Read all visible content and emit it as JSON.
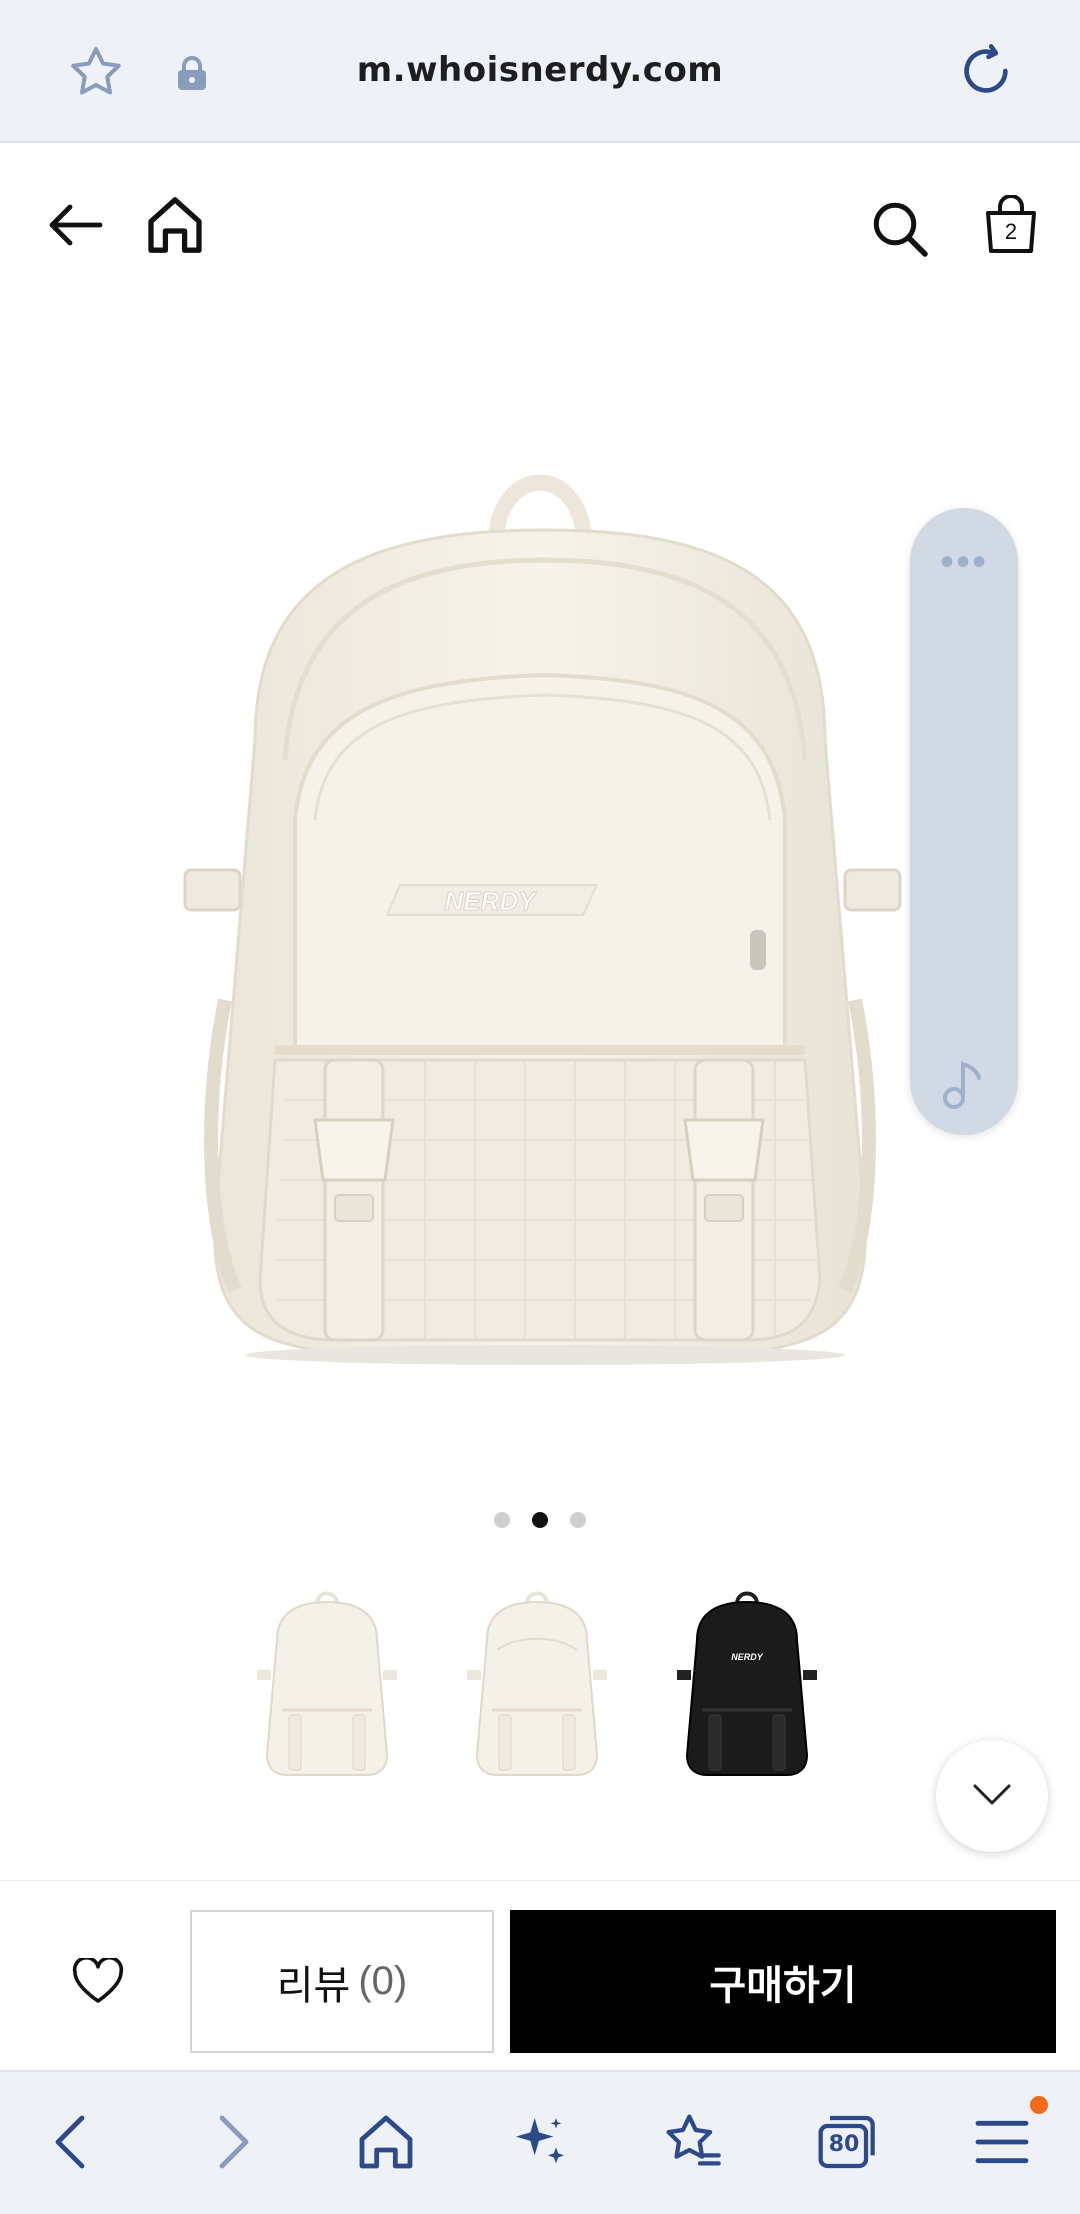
{
  "browser": {
    "url": "m.whoisnerdy.com",
    "tab_count": "80"
  },
  "header": {
    "cart_count": "2"
  },
  "product": {
    "logo_text": "NERDY",
    "thumb_logo_text": "NERDY",
    "image_index": 2,
    "image_total": 3
  },
  "actions": {
    "review_label": "리뷰",
    "review_count": "(0)",
    "buy_label": "구매하기"
  },
  "icons": [
    "star-icon",
    "lock-icon",
    "reload-icon",
    "back-arrow-icon",
    "home-icon",
    "search-icon",
    "shopping-bag-icon",
    "more-dots-icon",
    "music-note-icon",
    "chevron-down-icon",
    "heart-icon",
    "nav-back-icon",
    "nav-forward-icon",
    "nav-home-icon",
    "sparkle-icon",
    "bookmarks-icon",
    "tabs-icon",
    "menu-icon"
  ],
  "colors": {
    "accent": "#2c4a8a",
    "buy_button": "#000000",
    "notification_dot": "#f26b1d",
    "bag_cream": "#f3efe4"
  }
}
